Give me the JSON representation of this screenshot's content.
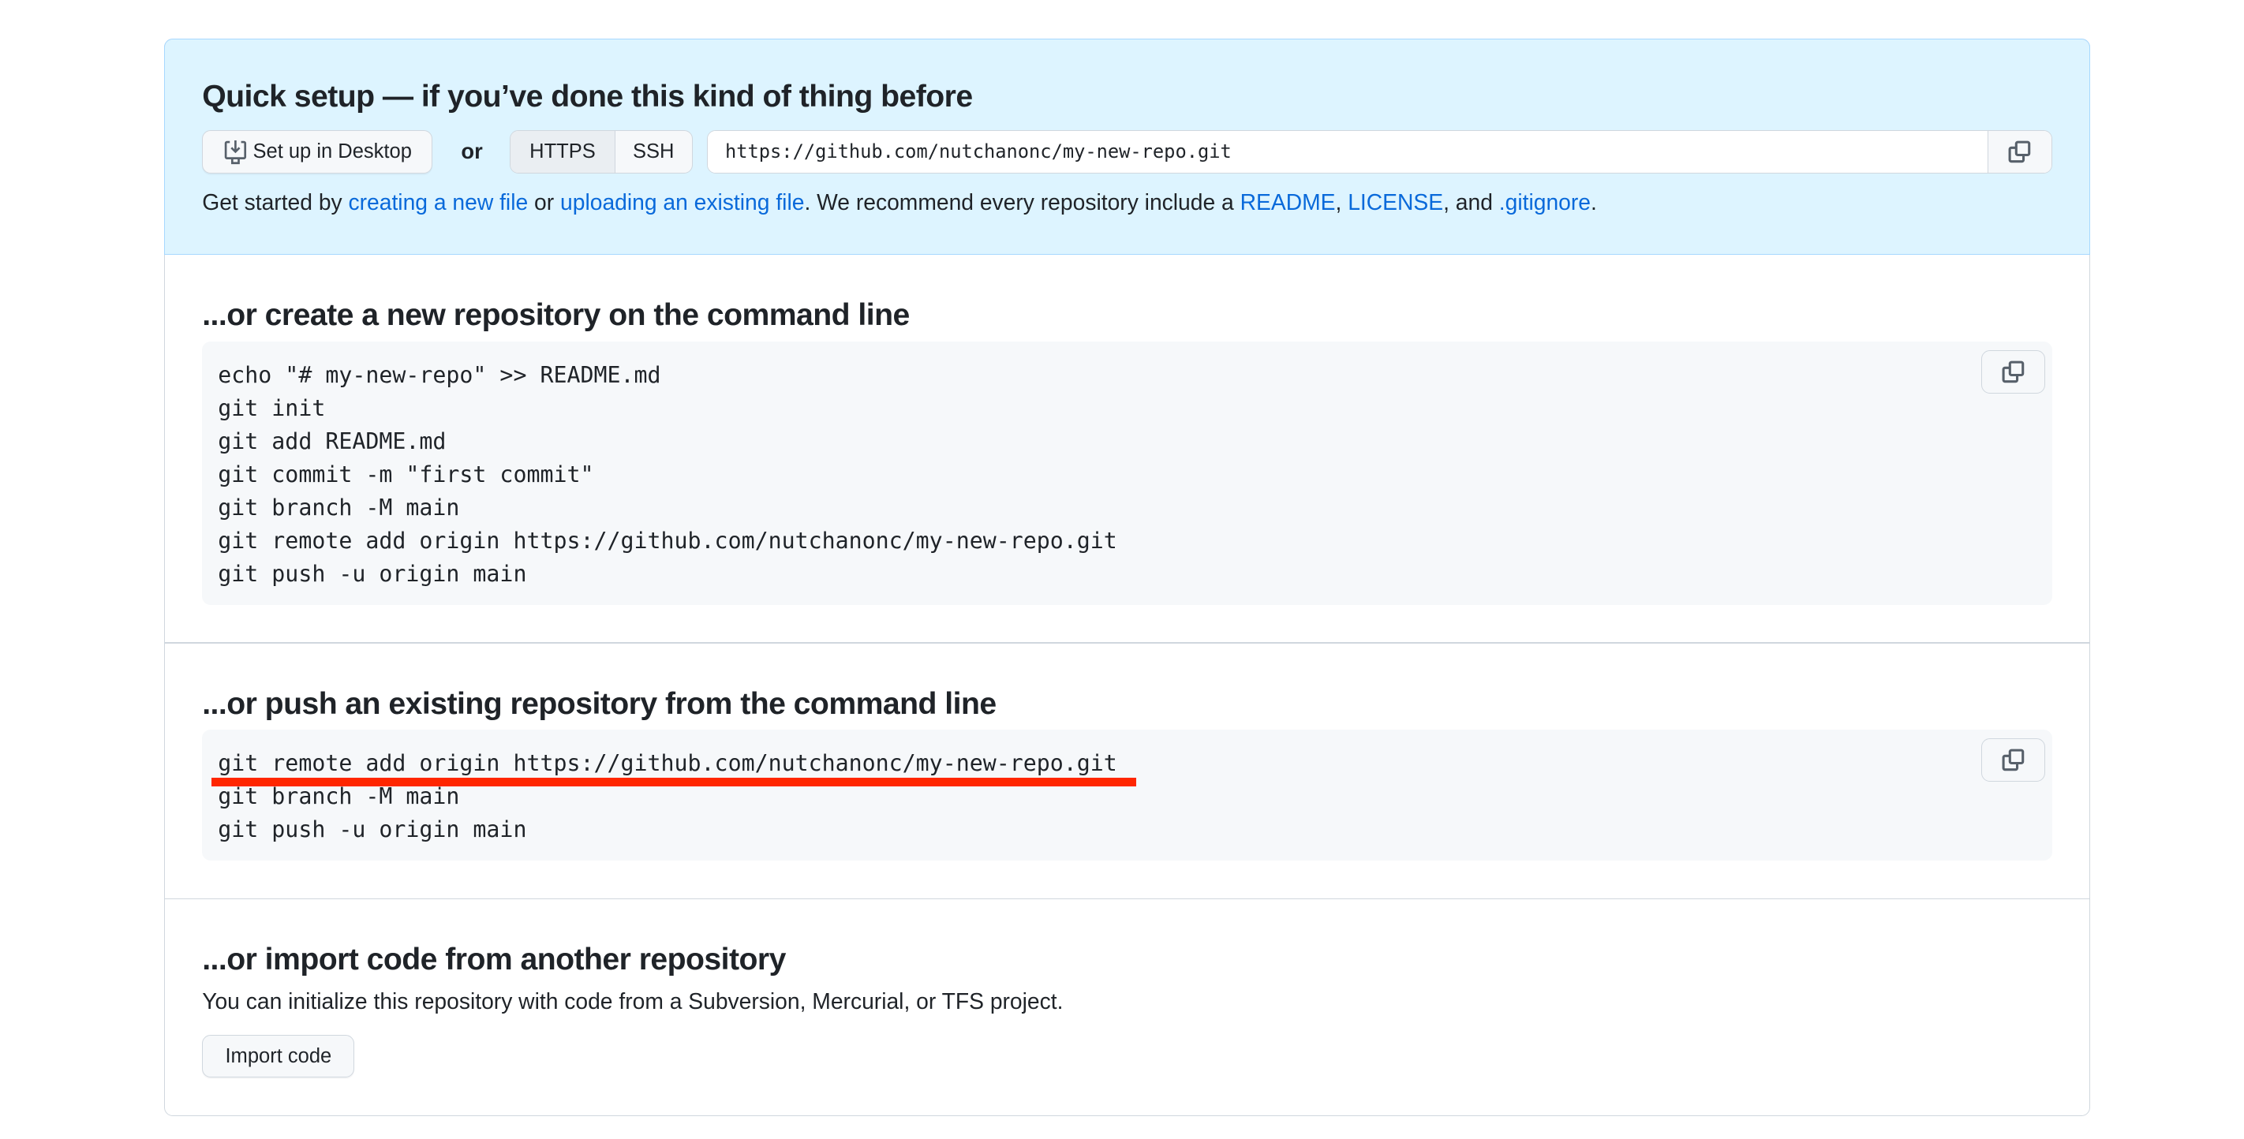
{
  "quick_setup": {
    "title": "Quick setup — if you’ve done this kind of thing before",
    "desktop_button": "Set up in Desktop",
    "or": "or",
    "protocols": [
      "HTTPS",
      "SSH"
    ],
    "selected_protocol": "HTTPS",
    "clone_url": "https://github.com/nutchanonc/my-new-repo.git",
    "intro": {
      "t1": "Get started by ",
      "link1": "creating a new file",
      "t2": " or ",
      "link2": "uploading an existing file",
      "t3": ". We recommend every repository include a ",
      "link3": "README",
      "t4": ", ",
      "link4": "LICENSE",
      "t5": ", and ",
      "link5": ".gitignore",
      "t6": "."
    }
  },
  "create_section": {
    "title": "...or create a new repository on the command line",
    "code": "echo \"# my-new-repo\" >> README.md\ngit init\ngit add README.md\ngit commit -m \"first commit\"\ngit branch -M main\ngit remote add origin https://github.com/nutchanonc/my-new-repo.git\ngit push -u origin main"
  },
  "push_section": {
    "title": "...or push an existing repository from the command line",
    "code": "git remote add origin https://github.com/nutchanonc/my-new-repo.git\ngit branch -M main\ngit push -u origin main",
    "highlight_color": "#ff2600"
  },
  "import_section": {
    "title": "...or import code from another repository",
    "description": "You can initialize this repository with code from a Subversion, Mercurial, or TFS project.",
    "button": "Import code"
  },
  "icons": [
    "desktop-download-icon",
    "copy-icon"
  ]
}
